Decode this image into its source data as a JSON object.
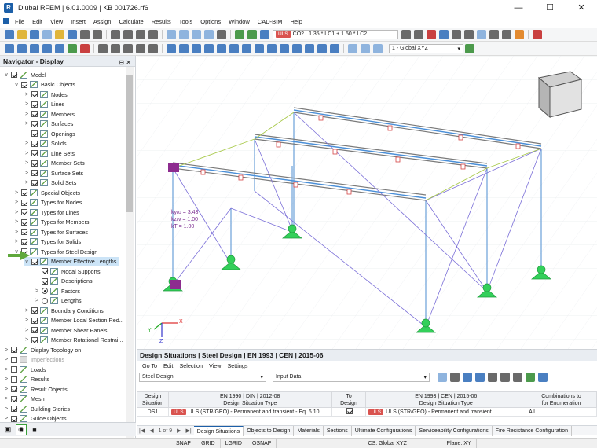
{
  "window": {
    "title": "Dlubal RFEM | 6.01.0009 | KB 001726.rf6",
    "min": "—",
    "max": "☐",
    "close": "✕"
  },
  "menu": [
    "File",
    "Edit",
    "View",
    "Insert",
    "Assign",
    "Calculate",
    "Results",
    "Tools",
    "Options",
    "Window",
    "CAD-BIM",
    "Help"
  ],
  "toolbar": {
    "uls_badge": "ULS",
    "combo_id": "CO2",
    "combo_formula": "1.35 * LC1 + 1.50 * LC2",
    "coord_system": "1 - Global XYZ"
  },
  "navigator": {
    "title": "Navigator - Display",
    "items": [
      {
        "label": "Model",
        "level": 0,
        "exp": "∨",
        "cb": "on"
      },
      {
        "label": "Basic Objects",
        "level": 1,
        "exp": "∨",
        "cb": "on"
      },
      {
        "label": "Nodes",
        "level": 2,
        "exp": ">",
        "cb": "on"
      },
      {
        "label": "Lines",
        "level": 2,
        "exp": ">",
        "cb": "on"
      },
      {
        "label": "Members",
        "level": 2,
        "exp": ">",
        "cb": "on"
      },
      {
        "label": "Surfaces",
        "level": 2,
        "exp": ">",
        "cb": "on"
      },
      {
        "label": "Openings",
        "level": 2,
        "exp": "",
        "cb": "on"
      },
      {
        "label": "Solids",
        "level": 2,
        "exp": ">",
        "cb": "on"
      },
      {
        "label": "Line Sets",
        "level": 2,
        "exp": ">",
        "cb": "on"
      },
      {
        "label": "Member Sets",
        "level": 2,
        "exp": ">",
        "cb": "on"
      },
      {
        "label": "Surface Sets",
        "level": 2,
        "exp": ">",
        "cb": "on"
      },
      {
        "label": "Solid Sets",
        "level": 2,
        "exp": ">",
        "cb": "on"
      },
      {
        "label": "Special Objects",
        "level": 1,
        "exp": ">",
        "cb": "on"
      },
      {
        "label": "Types for Nodes",
        "level": 1,
        "exp": ">",
        "cb": "on"
      },
      {
        "label": "Types for Lines",
        "level": 1,
        "exp": ">",
        "cb": "on"
      },
      {
        "label": "Types for Members",
        "level": 1,
        "exp": ">",
        "cb": "on"
      },
      {
        "label": "Types for Surfaces",
        "level": 1,
        "exp": ">",
        "cb": "on"
      },
      {
        "label": "Types for Solids",
        "level": 1,
        "exp": ">",
        "cb": "on"
      },
      {
        "label": "Types for Steel Design",
        "level": 1,
        "exp": "∨",
        "cb": "on"
      },
      {
        "label": "Member Effective Lengths",
        "level": 2,
        "exp": "∨",
        "cb": "on",
        "selected": true
      },
      {
        "label": "Nodal Supports",
        "level": 3,
        "exp": "",
        "cb": "on"
      },
      {
        "label": "Descriptions",
        "level": 3,
        "exp": "",
        "cb": "on"
      },
      {
        "label": "Factors",
        "level": 3,
        "exp": ">",
        "cb": "radio-on"
      },
      {
        "label": "Lengths",
        "level": 3,
        "exp": ">",
        "cb": "radio"
      },
      {
        "label": "Boundary Conditions",
        "level": 2,
        "exp": ">",
        "cb": "on"
      },
      {
        "label": "Member Local Section Red...",
        "level": 2,
        "exp": ">",
        "cb": "on"
      },
      {
        "label": "Member Shear Panels",
        "level": 2,
        "exp": ">",
        "cb": "on"
      },
      {
        "label": "Member Rotational Restrai...",
        "level": 2,
        "exp": ">",
        "cb": "on"
      },
      {
        "label": "Display Topology on",
        "level": 0,
        "exp": ">",
        "cb": "on"
      },
      {
        "label": "Imperfections",
        "level": 0,
        "exp": ">",
        "cb": "off",
        "gray": true
      },
      {
        "label": "Loads",
        "level": 0,
        "exp": ">",
        "cb": "off"
      },
      {
        "label": "Results",
        "level": 0,
        "exp": ">",
        "cb": "off"
      },
      {
        "label": "Result Objects",
        "level": 0,
        "exp": ">",
        "cb": "on"
      },
      {
        "label": "Mesh",
        "level": 0,
        "exp": ">",
        "cb": "on"
      },
      {
        "label": "Building Stories",
        "level": 0,
        "exp": ">",
        "cb": "on"
      },
      {
        "label": "Guide Objects",
        "level": 0,
        "exp": ">",
        "cb": "on"
      }
    ]
  },
  "viewport": {
    "label_ky": "ky/u = 3.43",
    "label_kz": "kz/v = 1.00",
    "label_kt": "kT = 1.00",
    "axis_x": "X",
    "axis_y": "Y",
    "axis_z": "Z"
  },
  "panel": {
    "title": "Design Situations | Steel Design | EN 1993 | CEN | 2015-06",
    "menu": [
      "Go To",
      "Edit",
      "Selection",
      "View",
      "Settings"
    ],
    "module_combo": "Steel Design",
    "data_combo": "Input Data",
    "headers": {
      "h1a": "Design",
      "h1b": "Situation",
      "h2a": "EN 1990 | DIN | 2012-08",
      "h2b": "Design Situation Type",
      "h3a": "To",
      "h3b": "Design",
      "h4a": "EN 1993 | CEN | 2015-06",
      "h4b": "Design Situation Type",
      "h5a": "Combinations to",
      "h5b": "for Enumeration"
    },
    "row": {
      "id": "DS1",
      "badge": "ULS",
      "type1": "ULS (STR/GEO) - Permanent and transient - Eq. 6.10",
      "badge2": "ULS",
      "type2": "ULS (STR/GEO) - Permanent and transient",
      "comb": "All"
    },
    "pager": "1 of 9",
    "tabs": [
      "Design Situations",
      "Objects to Design",
      "Materials",
      "Sections",
      "Ultimate Configurations",
      "Serviceability Configurations",
      "Fire Resistance Configuration"
    ]
  },
  "status": [
    "SNAP",
    "GRID",
    "LGRID",
    "OSNAP",
    "CS: Global XYZ",
    "Plane: XY"
  ]
}
